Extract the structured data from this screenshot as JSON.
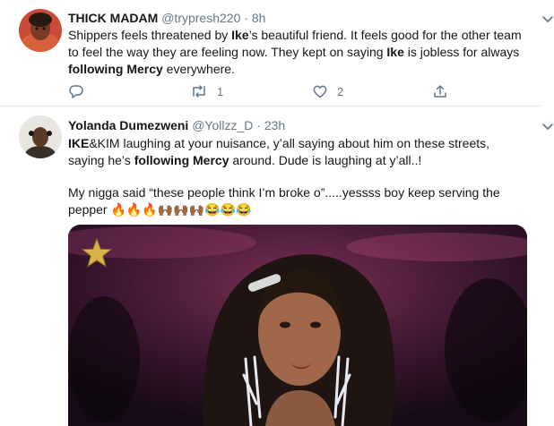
{
  "tweets": [
    {
      "name": "THICK MADAM",
      "handle": "@trypresh220",
      "dot": "·",
      "time": "8h",
      "text": {
        "a": "Shippers feels threatened by ",
        "b": "Ike",
        "c": "’s beautiful friend. It feels good for the other team to feel the way they are feeling now. They kept on saying ",
        "d": "Ike",
        "e": " is jobless for always ",
        "f": "following Mercy",
        "g": " everywhere."
      },
      "reply_count": "",
      "retweet_count": "1",
      "like_count": "2"
    },
    {
      "name": "Yolanda Dumezweni",
      "handle": "@Yollzz_D",
      "dot": "·",
      "time": "23h",
      "text1": {
        "a": "IKE",
        "b": "&KIM laughing at your nuisance, y’all saying about him on these streets, saying he’s ",
        "c": "following Mercy",
        "d": " around. Dude is laughing at y’all..!"
      },
      "text2": {
        "a": "My nigga said “these people think I’m broke o”.....yessss boy keep serving the pepper ",
        "emoji": "🔥🔥🔥🙌🏾🙌🏾🙌🏾😂😂😂"
      }
    }
  ],
  "colors": {
    "text": "#14171a",
    "secondary": "#657786",
    "divider": "#e6ecf0"
  },
  "icons": [
    "chevron-down-icon",
    "reply-icon",
    "retweet-icon",
    "like-icon",
    "share-icon",
    "star-icon"
  ]
}
